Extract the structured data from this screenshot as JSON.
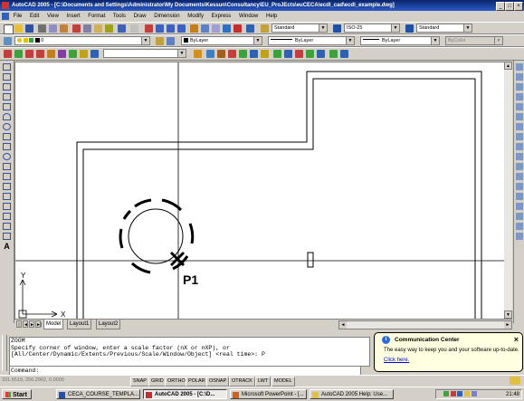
{
  "window": {
    "title": "AutoCAD 2005 - [C:\\Documents and Settings\\Administrator\\My Documents\\Kessun\\Consultancy\\EU_ProJEcts\\euCECA\\ecdl_cad\\ecdl_example.dwg]",
    "min_label": "_",
    "max_label": "□",
    "close_label": "×"
  },
  "menu": [
    "File",
    "Edit",
    "View",
    "Insert",
    "Format",
    "Tools",
    "Draw",
    "Dimension",
    "Modify",
    "Express",
    "Window",
    "Help"
  ],
  "styles": {
    "text_style": "Standard",
    "dim_style": "ISO-25",
    "table_style": "Standard"
  },
  "layers": {
    "current_layer": "0",
    "color": "ByLayer",
    "linetype": "ByLayer",
    "lineweight": "ByLayer",
    "plot_style": "ByColor"
  },
  "drawing": {
    "point_label": "P1",
    "ucs_x": "X",
    "ucs_y": "Y"
  },
  "layout_tabs": [
    "Model",
    "Layout1",
    "Layout2"
  ],
  "command_window": {
    "history": "ZOOM\nSpecify corner of window, enter a scale factor (nX or nXP), or\n[All/Center/Dynamic/Extents/Previous/Scale/Window/Object] <real time>: P",
    "prompt": "Command:"
  },
  "status": {
    "coords": "331.6519, 256.2962, 0.0000",
    "toggles": [
      "SNAP",
      "GRID",
      "ORTHO",
      "POLAR",
      "OSNAP",
      "OTRACK",
      "LWT",
      "MODEL"
    ]
  },
  "notification": {
    "title": "Communication Center",
    "body": "The easy way to keep you and your software up-to-date.",
    "link": "Click here."
  },
  "taskbar": {
    "start": "Start",
    "tasks": [
      "CECA_COURSE_TEMPLA...",
      "AutoCAD 2005 - [C:\\D...",
      "Microsoft PowerPoint - [...",
      "AutoCAD 2005 Help: Use..."
    ],
    "clock": "21:48"
  },
  "colors": {
    "titlebar": "#0a246a",
    "canvas": "#ffffff",
    "point_marker": "#000000"
  }
}
